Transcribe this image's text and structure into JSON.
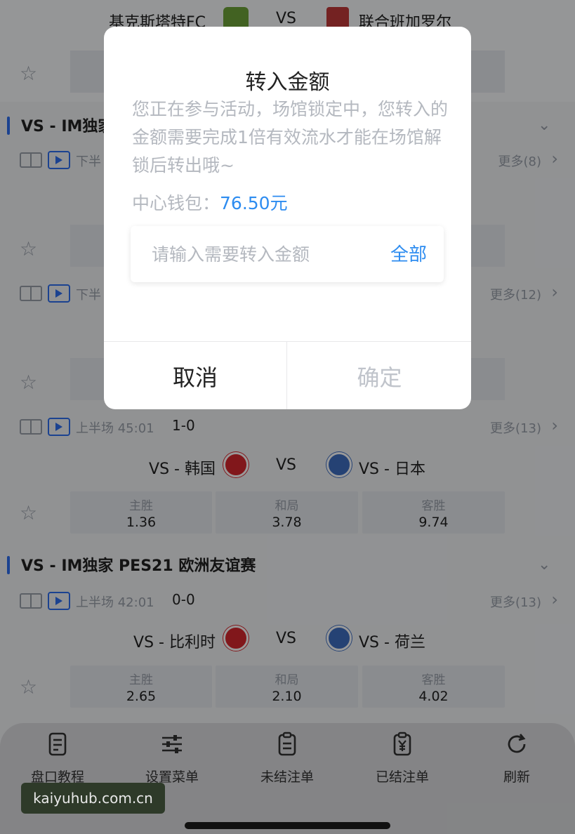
{
  "top_match": {
    "home": "基克斯塔特FC",
    "vs": "VS",
    "away": "联合班加罗尔"
  },
  "leagues": [
    {
      "title": "VS - IM独家"
    },
    {
      "title": "VS - IM独家 PES21 欧洲友谊赛"
    }
  ],
  "rows": [
    {
      "period": "下半",
      "more": "更多(8)"
    },
    {
      "period": "下半",
      "more": "更多(12)"
    },
    {
      "period": "上半场 45:01",
      "score": "1-0",
      "more": "更多(13)",
      "home": "VS - 韩国",
      "vs": "VS",
      "away": "VS - 日本",
      "odds": [
        {
          "label": "主胜",
          "value": "1.36"
        },
        {
          "label": "和局",
          "value": "3.78"
        },
        {
          "label": "客胜",
          "value": "9.74"
        }
      ]
    },
    {
      "period": "上半场 42:01",
      "score": "0-0",
      "more": "更多(13)",
      "home": "VS - 比利时",
      "vs": "VS",
      "away": "VS - 荷兰",
      "odds": [
        {
          "label": "主胜",
          "value": "2.65"
        },
        {
          "label": "和局",
          "value": "2.10"
        },
        {
          "label": "客胜",
          "value": "4.02"
        }
      ]
    }
  ],
  "modal": {
    "title": "转入金额",
    "description": "您正在参与活动，场馆锁定中，您转入的金额需要完成1倍有效流水才能在场馆解锁后转出哦~",
    "wallet_label": "中心钱包：",
    "wallet_amount": "76.50元",
    "input_placeholder": "请输入需要转入金额",
    "all_label": "全部",
    "cancel_label": "取消",
    "confirm_label": "确定"
  },
  "tabbar": [
    {
      "label": "盘口教程",
      "icon": "document-icon"
    },
    {
      "label": "设置菜单",
      "icon": "sliders-icon"
    },
    {
      "label": "未结注单",
      "icon": "clipboard-icon"
    },
    {
      "label": "已结注单",
      "icon": "yen-clipboard-icon"
    },
    {
      "label": "刷新",
      "icon": "refresh-icon"
    }
  ],
  "watermark": "kaiyuhub.com.cn"
}
